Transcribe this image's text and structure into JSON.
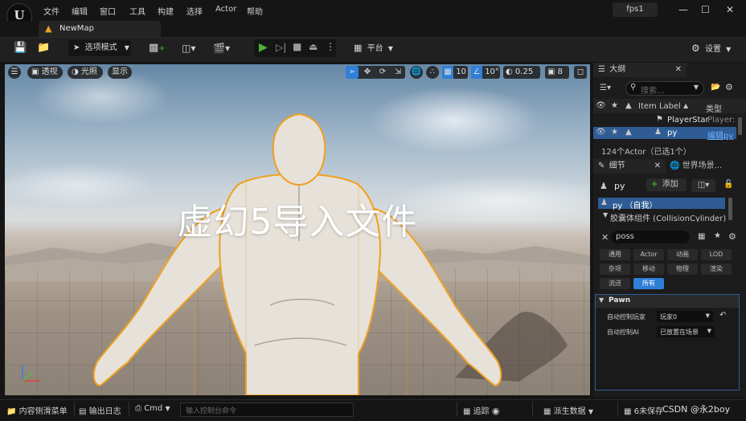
{
  "app": {
    "title": "fps1",
    "logo": "ue-logo"
  },
  "menu": [
    "文件",
    "编辑",
    "窗口",
    "工具",
    "构建",
    "选择",
    "Actor",
    "帮助"
  ],
  "tab": {
    "label": "NewMap"
  },
  "toolbar": {
    "select_mode": "选项模式",
    "platform": "平台",
    "settings": "设置"
  },
  "viewport": {
    "perspective": "透视",
    "lighting": "光照",
    "show": "显示",
    "grid_snap": "10",
    "angle_snap": "10°",
    "scale_snap": "0.25",
    "camera_speed": "8",
    "overlay_text": "虚幻5导入文件"
  },
  "outliner": {
    "title": "大纲",
    "search_placeholder": "搜索...",
    "col_label": "Item Label",
    "col_type": "类型",
    "rows": [
      {
        "label": "PlayerStar",
        "type": "Player:"
      },
      {
        "label": "py",
        "type": "编辑py"
      }
    ],
    "status": "124个Actor（已选1个）"
  },
  "details": {
    "tab_details": "细节",
    "tab_world": "世界场景...",
    "actor_name": "py",
    "add_label": "添加",
    "components": [
      {
        "label": "py （自我）"
      },
      {
        "label": "胶囊体组件 (CollisionCylinder)"
      }
    ],
    "search_value": "poss",
    "categories": [
      "通用",
      "Actor",
      "动画",
      "LOD",
      "杂项",
      "移动",
      "物理",
      "渲染",
      "流送",
      "所有"
    ],
    "section": "Pawn",
    "props": [
      {
        "label": "自动控制玩家",
        "value": "玩家0"
      },
      {
        "label": "自动控制AI",
        "value": "已放置在场景"
      }
    ]
  },
  "statusbar": {
    "content_drawer": "内容侧滑菜单",
    "output_log": "输出日志",
    "cmd": "Cmd",
    "console_placeholder": "输入控制台命令",
    "trace": "追踪",
    "derived_data": "派生数据",
    "unsaved": "6未保存",
    "watermark": "CSDN @永2boy"
  },
  "colors": {
    "accent": "#2f7fd8",
    "selection": "#f0a020",
    "play": "#4caf3a"
  }
}
